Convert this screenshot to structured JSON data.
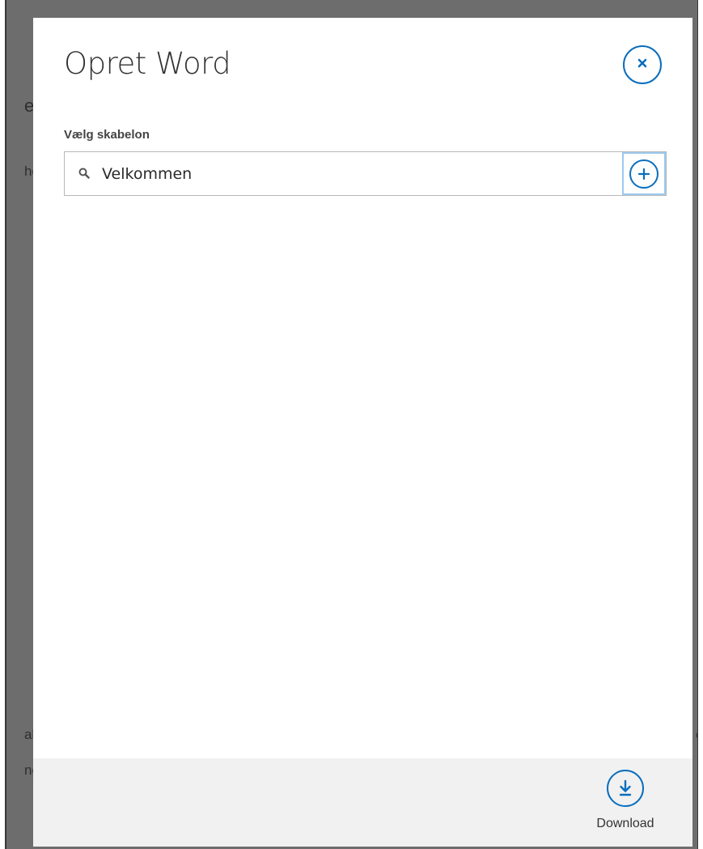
{
  "background": {
    "fragments": [
      "er",
      "ho",
      "al",
      "ng",
      "e"
    ]
  },
  "dialog": {
    "title": "Opret Word",
    "close_icon": "close-icon",
    "template_label": "Vælg skabelon",
    "search": {
      "value": "Velkommen",
      "icon": "search-icon"
    },
    "add_icon": "plus-circle-icon",
    "footer": {
      "download_label": "Download",
      "download_icon": "download-icon"
    }
  },
  "colors": {
    "accent": "#0a6ebd",
    "overlay": "#6d6d6d",
    "footer_bg": "#f1f1f1"
  }
}
